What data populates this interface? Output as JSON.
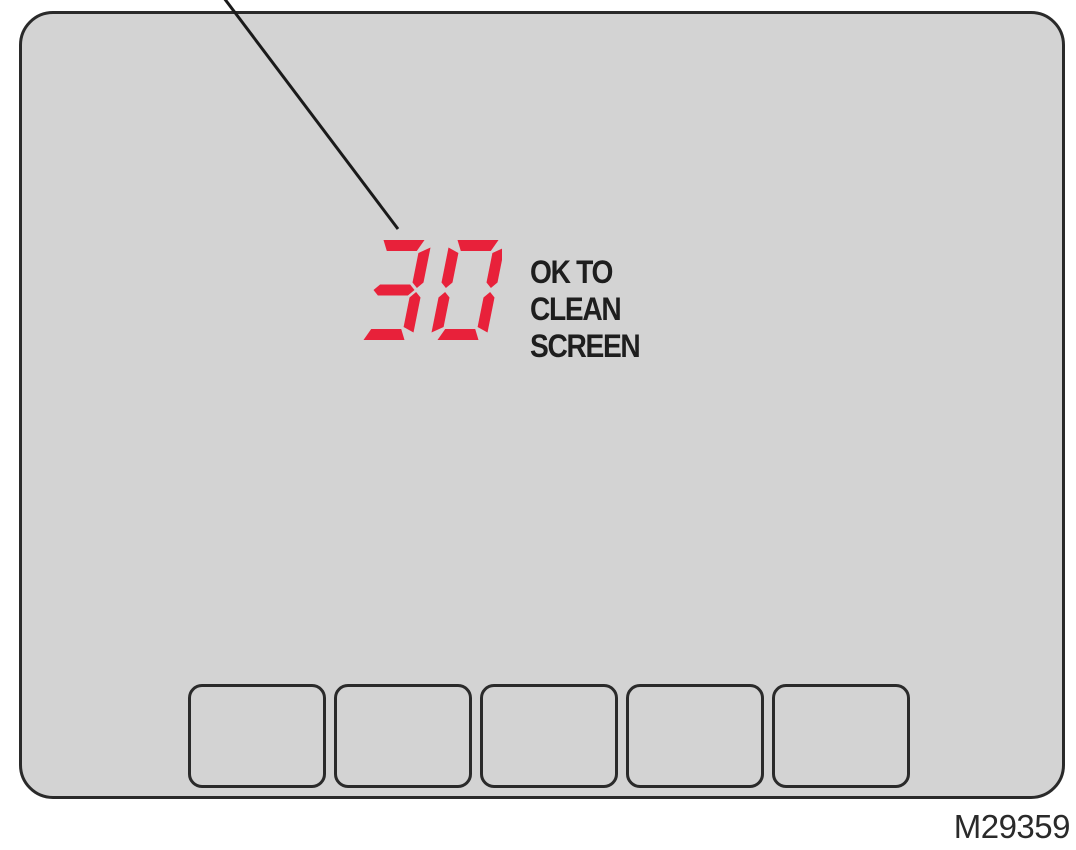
{
  "display": {
    "countdown": "30",
    "digit_color": "#e8213a",
    "message_lines": [
      "OK TO",
      "CLEAN",
      "SCREEN"
    ]
  },
  "softkeys": [
    {
      "label": ""
    },
    {
      "label": ""
    },
    {
      "label": ""
    },
    {
      "label": ""
    },
    {
      "label": ""
    }
  ],
  "figure_id": "M29359",
  "colors": {
    "screen_background": "#d3d3d3",
    "outline": "#2a2a2a"
  }
}
